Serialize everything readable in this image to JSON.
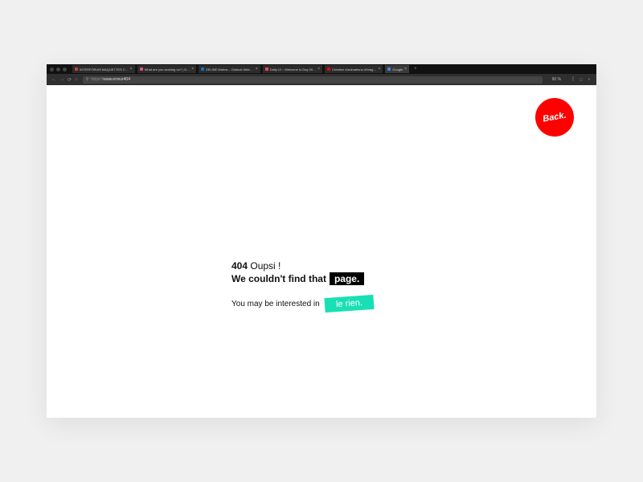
{
  "tabs": [
    {
      "label": "INTERFORUM MAQUETTES C…",
      "favicon": "#d63a3a"
    },
    {
      "label": "What are you working on? | D…",
      "favicon": "#ea4c89"
    },
    {
      "label": "ZELINE Maëva – Outlook Web …",
      "favicon": "#0078d4"
    },
    {
      "label": "Daily UI :: Welcome to Day 00…",
      "favicon": "#ff4755"
    },
    {
      "label": "Création d'animations d'imag…",
      "favicon": "#ff0000"
    },
    {
      "label": "Google",
      "favicon": "#4285f4",
      "active": true
    }
  ],
  "newtab_glyph": "+",
  "nav": {
    "back": "←",
    "forward": "→",
    "reload": "⟳",
    "home": "⌂"
  },
  "address": {
    "protocol": "https://",
    "host": "www.erreur404",
    "search_icon": "⚲"
  },
  "zoom": "90 %",
  "right_icons": {
    "library": "⫿",
    "account": "◻",
    "menu": "≡"
  },
  "page": {
    "back_button": "Back.",
    "code": "404",
    "oupsi": "Oupsi !",
    "line2_prefix": "We couldn't find that",
    "page_chip": "page.",
    "line3_prefix": "You may be interested in",
    "rien_chip": "le rien."
  }
}
